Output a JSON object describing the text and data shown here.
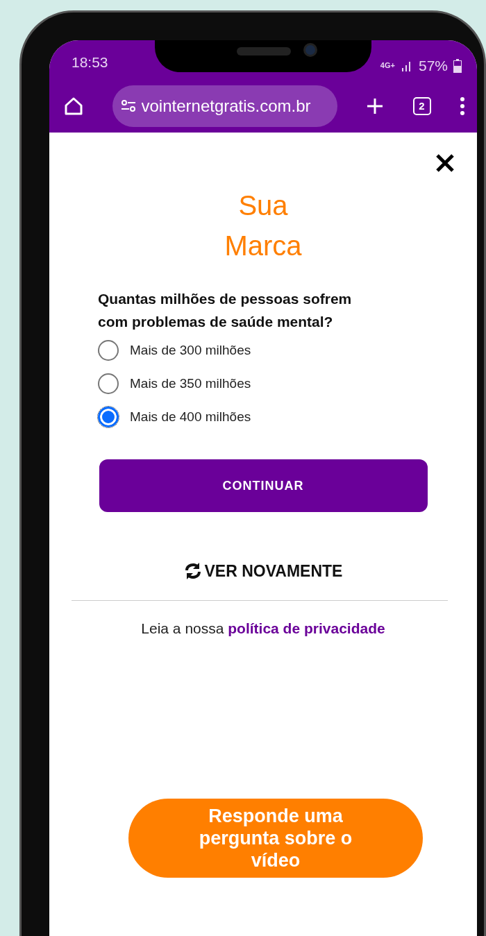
{
  "status_bar": {
    "time": "18:53",
    "network": "4G+",
    "battery": {
      "reading": "57%",
      "level": 0.57
    }
  },
  "browser": {
    "url": "vointernetgratis.com.br",
    "tab_count": "2"
  },
  "brand": {
    "line_1": "Sua",
    "line_2": "Marca"
  },
  "question": "Quantas milhões de pessoas sofrem com problemas de saúde mental?",
  "options": [
    {
      "label": "Mais de 300 milhões",
      "selected": false
    },
    {
      "label": "Mais de 350 milhões",
      "selected": false
    },
    {
      "label": "Mais de 400 milhões",
      "selected": true
    }
  ],
  "continue_button": "CONTINUAR",
  "replay_link": "VER NOVAMENTE",
  "privacy": {
    "text": "Leia a nossa",
    "link": "política de privacidade"
  },
  "cta": "Responde uma pergunta sobre o vídeo"
}
